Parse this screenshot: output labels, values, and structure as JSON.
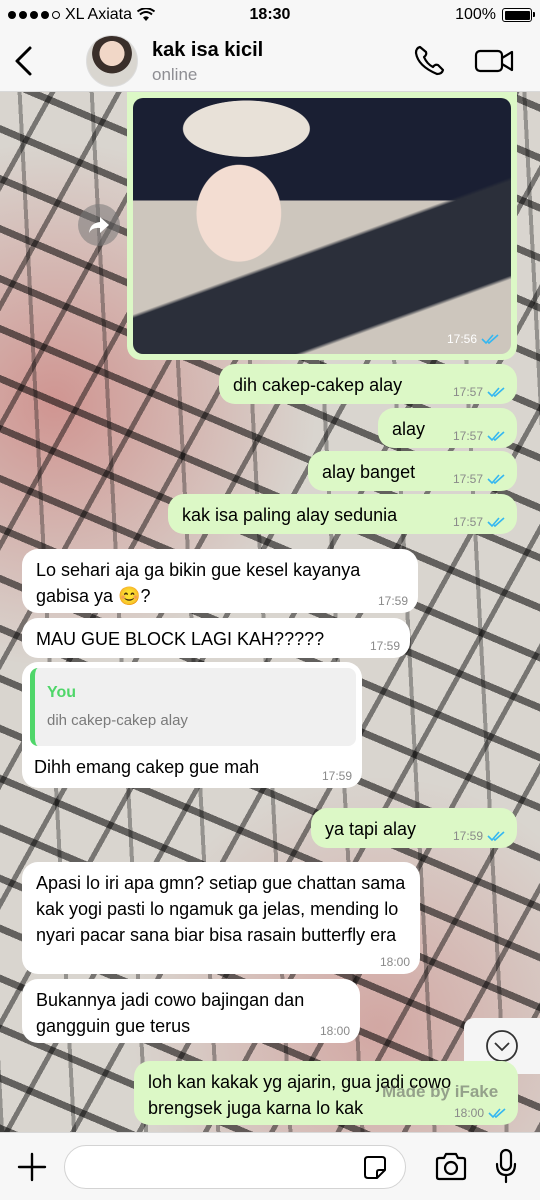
{
  "status_bar": {
    "carrier": "XL Axiata",
    "time": "18:30",
    "battery": "100%",
    "battery_level": 1.0
  },
  "header": {
    "back_icon": "chevron-left-icon",
    "contact_name": "kak isa kicil",
    "contact_status": "online",
    "call_icon": "phone-icon",
    "video_icon": "video-camera-icon"
  },
  "colors": {
    "outgoing_bubble": "#dcf8c6",
    "incoming_bubble": "#ffffff",
    "read_ticks": "#34b7f1",
    "quote_accent": "#4fd669"
  },
  "messages": [
    {
      "type": "image",
      "direction": "out",
      "time": "17:56",
      "status": "read"
    },
    {
      "direction": "out",
      "text": "dih cakep-cakep alay",
      "time": "17:57",
      "status": "read"
    },
    {
      "direction": "out",
      "text": "alay",
      "time": "17:57",
      "status": "read"
    },
    {
      "direction": "out",
      "text": "alay banget",
      "time": "17:57",
      "status": "read"
    },
    {
      "direction": "out",
      "text": "kak isa paling alay sedunia",
      "time": "17:57",
      "status": "read"
    },
    {
      "direction": "in",
      "text": "Lo sehari aja ga bikin gue kesel kayanya gabisa ya 😊?",
      "time": "17:59"
    },
    {
      "direction": "in",
      "text": "MAU GUE BLOCK LAGI KAH?????",
      "time": "17:59"
    },
    {
      "direction": "in",
      "text": "Dihh emang cakep gue mah",
      "time": "17:59",
      "quote": {
        "author": "You",
        "text": "dih cakep-cakep alay"
      }
    },
    {
      "direction": "out",
      "text": "ya tapi alay",
      "time": "17:59",
      "status": "read"
    },
    {
      "direction": "in",
      "text": "Apasi lo iri apa gmn? setiap gue chattan sama kak yogi pasti lo ngamuk ga jelas, mending lo nyari pacar sana biar bisa rasain butterfly era",
      "time": "18:00"
    },
    {
      "direction": "in",
      "text": "Bukannya jadi cowo bajingan dan gangguin gue terus",
      "time": "18:00"
    },
    {
      "direction": "out",
      "text": "loh kan kakak yg ajarin, gua jadi cowo brengsek juga karna lo kak",
      "time": "18:00",
      "status": "read"
    }
  ],
  "watermark": "Made by iFake",
  "input_bar": {
    "plus_icon": "plus-icon",
    "value": "",
    "placeholder": "",
    "sticker_icon": "sticker-icon",
    "camera_icon": "camera-icon",
    "mic_icon": "microphone-icon"
  },
  "scroll_icon": "chevron-down-circle-icon"
}
